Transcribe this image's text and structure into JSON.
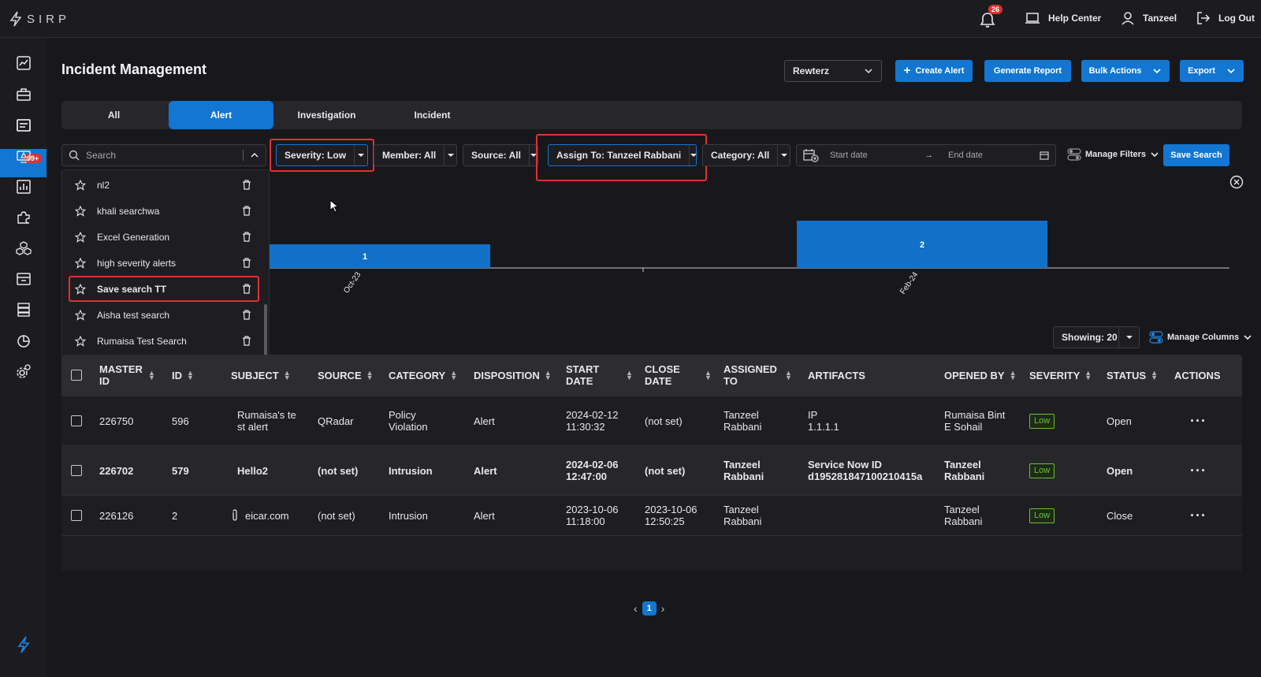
{
  "header": {
    "logo_text": "SIRP",
    "notification_count": "26",
    "help_label": "Help Center",
    "user_label": "Tanzeel",
    "logout_label": "Log Out"
  },
  "sidebar": {
    "badge": "99+",
    "items": [
      "dashboard-icon",
      "briefcase-icon",
      "alerts-icon",
      "threat-icon",
      "analytics-icon",
      "puzzle-icon",
      "cubes-icon",
      "assets-icon",
      "database-icon",
      "report-icon",
      "settings-icon"
    ]
  },
  "page": {
    "title": "Incident Management",
    "tenant_select": "Rewterz",
    "create_alert": "Create Alert",
    "generate_report": "Generate Report",
    "bulk_actions": "Bulk Actions",
    "export": "Export"
  },
  "tabs": [
    {
      "label": "All"
    },
    {
      "label": "Alert"
    },
    {
      "label": "Investigation"
    },
    {
      "label": "Incident"
    }
  ],
  "filters": {
    "search_placeholder": "Search",
    "severity": "Severity: Low",
    "member": "Member: All",
    "source": "Source: All",
    "assign_to": "Assign To: Tanzeel Rabbani",
    "category": "Category: All",
    "start_date": "Start date",
    "end_date": "End date",
    "manage_filters": "Manage Filters",
    "save_search": "Save Search"
  },
  "saved_searches": [
    {
      "name": "nl2"
    },
    {
      "name": "khali searchwa"
    },
    {
      "name": "Excel Generation"
    },
    {
      "name": "high severity alerts"
    },
    {
      "name": "Save search TT"
    },
    {
      "name": "Aisha test search"
    },
    {
      "name": "Rumaisa Test Search"
    }
  ],
  "chart_data": {
    "type": "bar",
    "categories": [
      "Oct-23",
      "Feb-24"
    ],
    "values": [
      1,
      2
    ],
    "ylim": [
      0,
      2
    ]
  },
  "table_controls": {
    "showing": "Showing: 20",
    "manage_columns": "Manage Columns"
  },
  "table": {
    "columns": [
      "MASTER ID",
      "ID",
      "SUBJECT",
      "SOURCE",
      "CATEGORY",
      "DISPOSITION",
      "START DATE",
      "CLOSE DATE",
      "ASSIGNED TO",
      "ARTIFACTS",
      "OPENED BY",
      "SEVERITY",
      "STATUS",
      "ACTIONS"
    ],
    "rows": [
      {
        "master_id": "226750",
        "id": "596",
        "subject_1": "Rumaisa's te",
        "subject_2": "st alert",
        "source": "QRadar",
        "category_1": "Policy",
        "category_2": "Violation",
        "disposition": "Alert",
        "start_1": "2024-02-12",
        "start_2": "11:30:32",
        "close_1": "(not set)",
        "close_2": "",
        "assigned_1": "Tanzeel",
        "assigned_2": "Rabbani",
        "artifacts_1": "IP",
        "artifacts_2": "1.1.1.1",
        "opened_1": "Rumaisa Bint",
        "opened_2": "E Sohail",
        "severity": "Low",
        "status": "Open"
      },
      {
        "master_id": "226702",
        "id": "579",
        "subject_1": "Hello2",
        "subject_2": "",
        "source": "(not set)",
        "category_1": "Intrusion",
        "category_2": "",
        "disposition": "Alert",
        "start_1": "2024-02-06",
        "start_2": "12:47:00",
        "close_1": "(not set)",
        "close_2": "",
        "assigned_1": "Tanzeel",
        "assigned_2": "Rabbani",
        "artifacts_1": "Service Now ID",
        "artifacts_2": "d195281847100210415a",
        "opened_1": "Tanzeel",
        "opened_2": "Rabbani",
        "severity": "Low",
        "status": "Open"
      },
      {
        "master_id": "226126",
        "id": "2",
        "subject_1": "eicar.com",
        "subject_2": "",
        "source": "(not set)",
        "category_1": "Intrusion",
        "category_2": "",
        "disposition": "Alert",
        "start_1": "2023-10-06",
        "start_2": "11:18:00",
        "close_1": "2023-10-06",
        "close_2": "12:50:25",
        "assigned_1": "Tanzeel",
        "assigned_2": "Rabbani",
        "artifacts_1": "",
        "artifacts_2": "",
        "opened_1": "Tanzeel",
        "opened_2": "Rabbani",
        "severity": "Low",
        "status": "Close"
      }
    ]
  },
  "pagination": {
    "current": "1"
  }
}
